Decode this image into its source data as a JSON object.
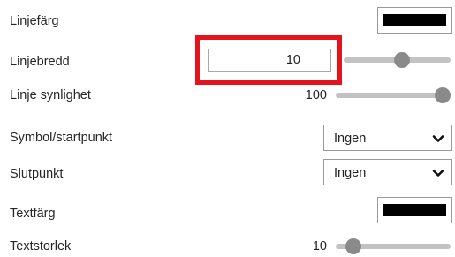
{
  "properties": {
    "line_color": {
      "label": "Linjefärg",
      "color": "#000000"
    },
    "line_width": {
      "label": "Linjebredd",
      "value": "10",
      "slider_fraction": 0.55
    },
    "line_visibility": {
      "label": "Linje synlighet",
      "value": "100",
      "slider_fraction": 1.0
    },
    "start_symbol": {
      "label": "Symbol/startpunkt",
      "selected": "Ingen"
    },
    "end_point": {
      "label": "Slutpunkt",
      "selected": "Ingen"
    },
    "text_color": {
      "label": "Textfärg",
      "color": "#000000"
    },
    "text_size": {
      "label": "Textstorlek",
      "value": "10",
      "slider_fraction": 0.1
    }
  },
  "icons": {
    "dropdown": "chevron-down-icon"
  },
  "accent_colors": {
    "highlight": "#e3141c",
    "slider_thumb": "#8a8a8a",
    "slider_track": "#c2c2c2"
  }
}
